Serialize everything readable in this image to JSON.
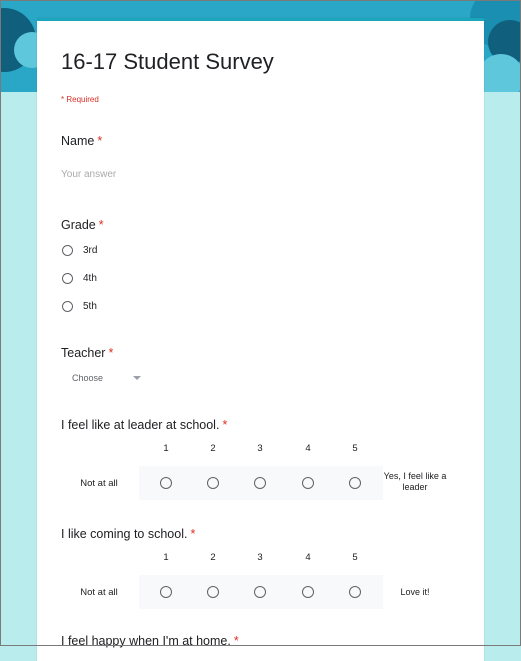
{
  "form": {
    "title": "16-17 Student Survey",
    "required_note": "* Required",
    "required_marker": "*",
    "colors": {
      "accent": "#1ca6be",
      "header_band": "#2aa7c6",
      "page_bg": "#b9ecec",
      "required": "#d93025"
    }
  },
  "questions": {
    "name": {
      "label": "Name",
      "placeholder": "Your answer"
    },
    "grade": {
      "label": "Grade",
      "options": [
        "3rd",
        "4th",
        "5th"
      ]
    },
    "teacher": {
      "label": "Teacher",
      "selected": "Choose"
    },
    "leader": {
      "label": "I feel like at leader at school.",
      "scale": [
        "1",
        "2",
        "3",
        "4",
        "5"
      ],
      "low_label": "Not at all",
      "high_label": "Yes, I feel like a leader"
    },
    "coming": {
      "label": "I like coming to school.",
      "scale": [
        "1",
        "2",
        "3",
        "4",
        "5"
      ],
      "low_label": "Not at all",
      "high_label": "Love it!"
    },
    "home": {
      "label": "I feel happy when I'm at home."
    }
  }
}
